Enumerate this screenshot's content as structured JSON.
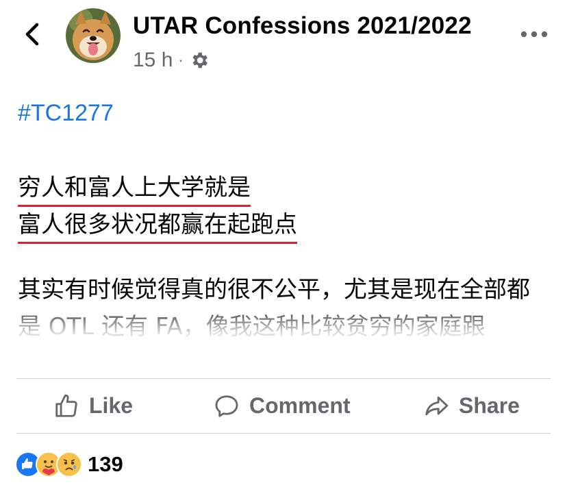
{
  "header": {
    "page_name": "UTAR Confessions 2021/2022",
    "time_ago": "15 h",
    "separator": "·"
  },
  "post": {
    "hashtag": "#TC1277",
    "highlight_lines": [
      "穷人和富人上大学就是",
      "富人很多状况都赢在起跑点"
    ],
    "paragraph": "其实有时候觉得真的很不公平，尤其是现在全部都是 OTL 还有 FA，像我这种比较贫穷的家庭跟"
  },
  "actions": {
    "like_label": "Like",
    "comment_label": "Comment",
    "share_label": "Share"
  },
  "reactions": {
    "icons": [
      "like-reaction-icon",
      "care-reaction-icon",
      "sad-reaction-icon"
    ],
    "count": "139"
  },
  "colors": {
    "accent": "#1b74e4",
    "underline": "#e41e2d",
    "secondary_text": "#65676b",
    "divider": "#ced0d4"
  }
}
